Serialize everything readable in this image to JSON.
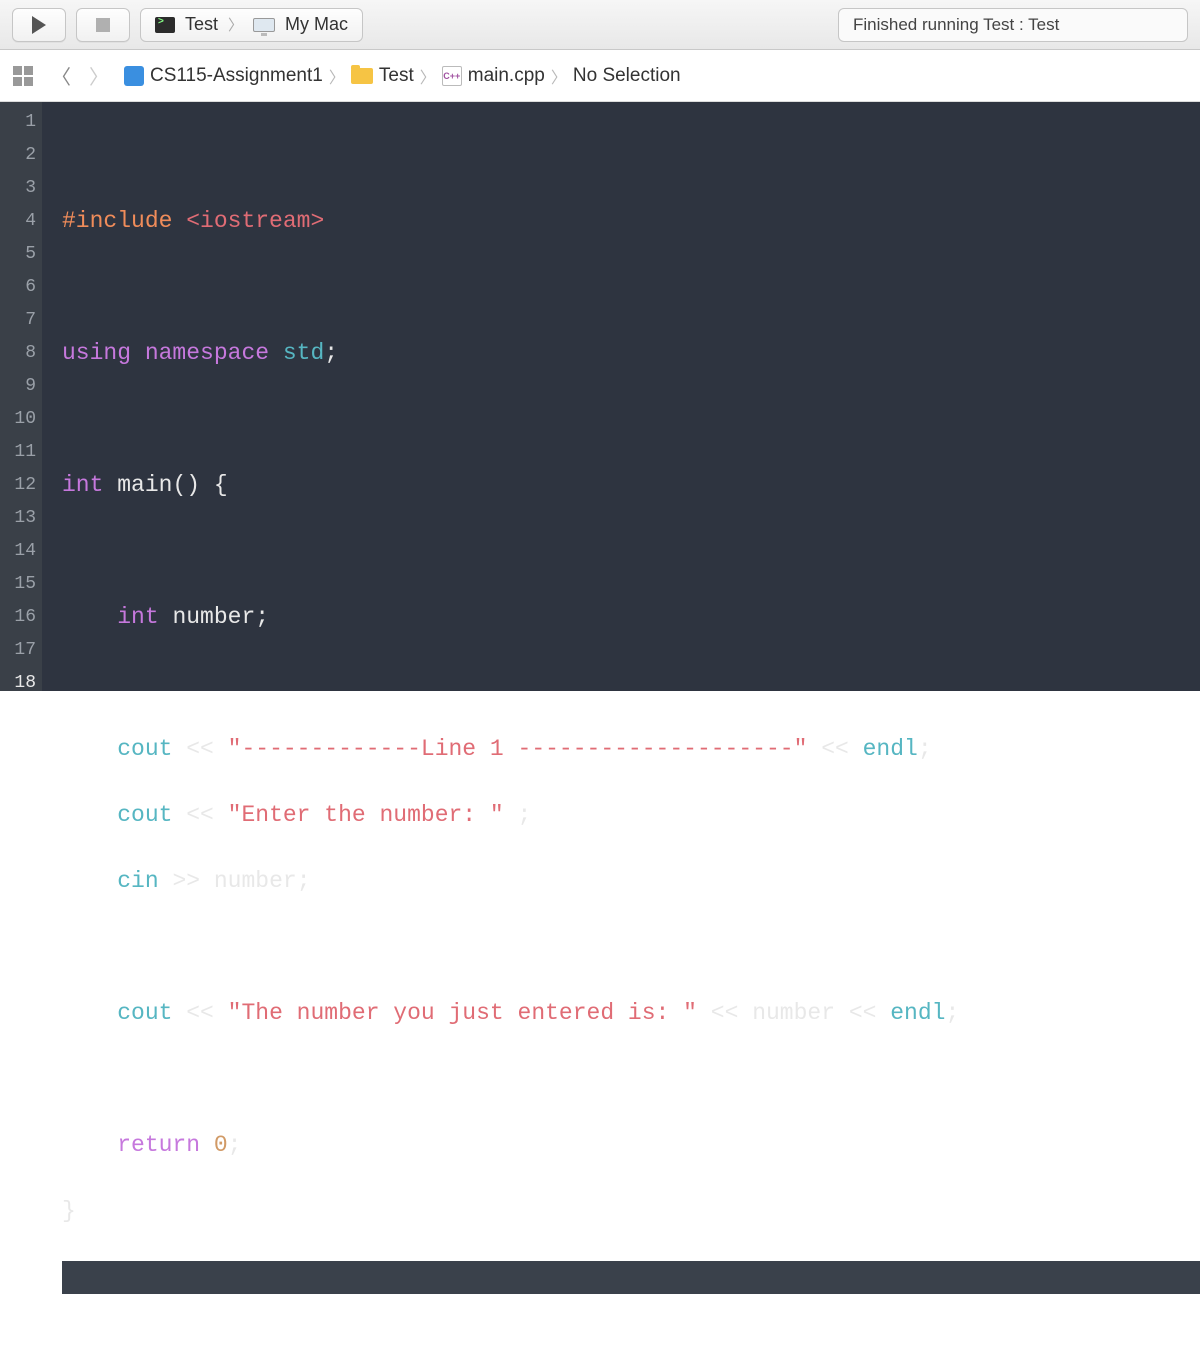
{
  "toolbar": {
    "scheme_target": "Test",
    "scheme_device": "My Mac",
    "status": "Finished running Test : Test"
  },
  "breadcrumb": {
    "project": "CS115-Assignment1",
    "folder": "Test",
    "file": "main.cpp",
    "file_icon_label": "C++",
    "selection": "No Selection"
  },
  "editor": {
    "current_line": 18,
    "line_numbers": [
      "1",
      "2",
      "3",
      "4",
      "5",
      "6",
      "7",
      "8",
      "9",
      "10",
      "11",
      "12",
      "13",
      "14",
      "15",
      "16",
      "17",
      "18"
    ],
    "code": {
      "l2_include": "#include",
      "l2_header": "<iostream>",
      "l4_using": "using",
      "l4_namespace": "namespace",
      "l4_std": "std",
      "l6_int": "int",
      "l6_main": "main() {",
      "l8_int": "int",
      "l8_number": "number;",
      "l10_cout": "cout",
      "l10_op": "<<",
      "l10_str": "\"-------------Line 1 --------------------\"",
      "l10_op2": "<<",
      "l10_endl": "endl",
      "l11_cout": "cout",
      "l11_op": "<<",
      "l11_str": "\"Enter the number: \"",
      "l11_semi": ";",
      "l12_cin": "cin",
      "l12_op": ">>",
      "l12_number": "number;",
      "l14_cout": "cout",
      "l14_op": "<<",
      "l14_str": "\"The number you just entered is: \"",
      "l14_op2": "<<",
      "l14_number": "number",
      "l14_op3": "<<",
      "l14_endl": "endl",
      "l16_return": "return",
      "l16_zero": "0",
      "l17_brace": "}"
    }
  }
}
